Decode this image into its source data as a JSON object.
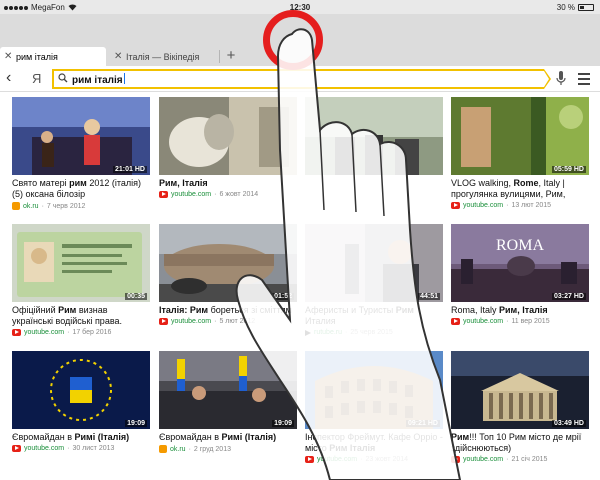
{
  "status": {
    "carrier": "MegaFon",
    "time": "12:30",
    "battery": "30 %",
    "battery_level": 0.3
  },
  "tabs": [
    {
      "label": "рим італія",
      "active": true
    },
    {
      "label": "Італія — Вікіпедія",
      "active": false
    }
  ],
  "new_tab_label": "+",
  "toolbar": {
    "back": "‹",
    "yandex": "Я",
    "query": "рим італія"
  },
  "videos": [
    {
      "title_pre": "Свято матері ",
      "title_bold": "рим",
      "title_post": " 2012 (італія) (5) оксана білозір",
      "duration": "21:01",
      "hd": "HD",
      "source": "ok.ru",
      "date": "7 черв 2012",
      "icon": "ok"
    },
    {
      "title_pre": "",
      "title_bold": "Рим, Італія",
      "title_post": "",
      "duration": "",
      "hd": "",
      "source": "youtube.com",
      "date": "6 жовт 2014",
      "icon": "yt"
    },
    {
      "title_pre": "",
      "title_bold": "",
      "title_post": "",
      "duration": "",
      "hd": "",
      "source": "",
      "date": "",
      "icon": ""
    },
    {
      "title_pre": "VLOG walking, ",
      "title_bold": "Rome",
      "title_post": ", Italy | прогулянка вулицями, Рим,",
      "duration": "05:59",
      "hd": "HD",
      "source": "youtube.com",
      "date": "13 лют 2015",
      "icon": "yt"
    },
    {
      "title_pre": "Офіційний ",
      "title_bold": "Рим",
      "title_post": " визнав українські водійські права.",
      "duration": "00:35",
      "hd": "",
      "source": "youtube.com",
      "date": "17 бер 2016",
      "icon": "yt"
    },
    {
      "title_pre": "",
      "title_bold": "Італія: Рим",
      "title_post": " бореться зі сміттям",
      "duration": "01:52",
      "hd": "",
      "source": "youtube.com",
      "date": "5 лют 2012",
      "icon": "yt"
    },
    {
      "title_pre": "Аферисты и Туристы ",
      "title_bold": "Рим",
      "title_post": " Италия",
      "duration": "44:51",
      "hd": "",
      "source": "rutube.ru",
      "date": "25 черв 2015",
      "icon": "ru"
    },
    {
      "title_pre": "Roma, Italy ",
      "title_bold": "Рим, Італія",
      "title_post": "",
      "duration": "03:27",
      "hd": "HD",
      "source": "youtube.com",
      "date": "11 вер 2015",
      "icon": "yt"
    },
    {
      "title_pre": "Євромайдан в ",
      "title_bold": "Римі (Італія)",
      "title_post": "",
      "duration": "19:09",
      "hd": "",
      "source": "youtube.com",
      "date": "30 лист 2013",
      "icon": "yt"
    },
    {
      "title_pre": "Євромайдан в ",
      "title_bold": "Римі (Італія)",
      "title_post": "",
      "duration": "19:09",
      "hd": "",
      "source": "ok.ru",
      "date": "2 груд 2013",
      "icon": "ok"
    },
    {
      "title_pre": "Інспектор Фреймут. Кафе Oppio - місто ",
      "title_bold": "Рим Італія",
      "title_post": "",
      "duration": "09:21",
      "hd": "HD",
      "source": "youtube.com",
      "date": "23 жовт 2014",
      "icon": "yt"
    },
    {
      "title_pre": "",
      "title_bold": "Рим",
      "title_post": "!!! Топ 10 Рим місто де мрії здійснюються)",
      "duration": "03:49",
      "hd": "HD",
      "source": "youtube.com",
      "date": "21 січ 2015",
      "icon": "yt"
    }
  ],
  "thumb_text": {
    "roma": "ROMA"
  },
  "colors": {
    "accent_yellow": "#f2c100",
    "tap_red": "#e51e1e",
    "source_green": "#1a8f3a",
    "youtube_red": "#e62117"
  }
}
